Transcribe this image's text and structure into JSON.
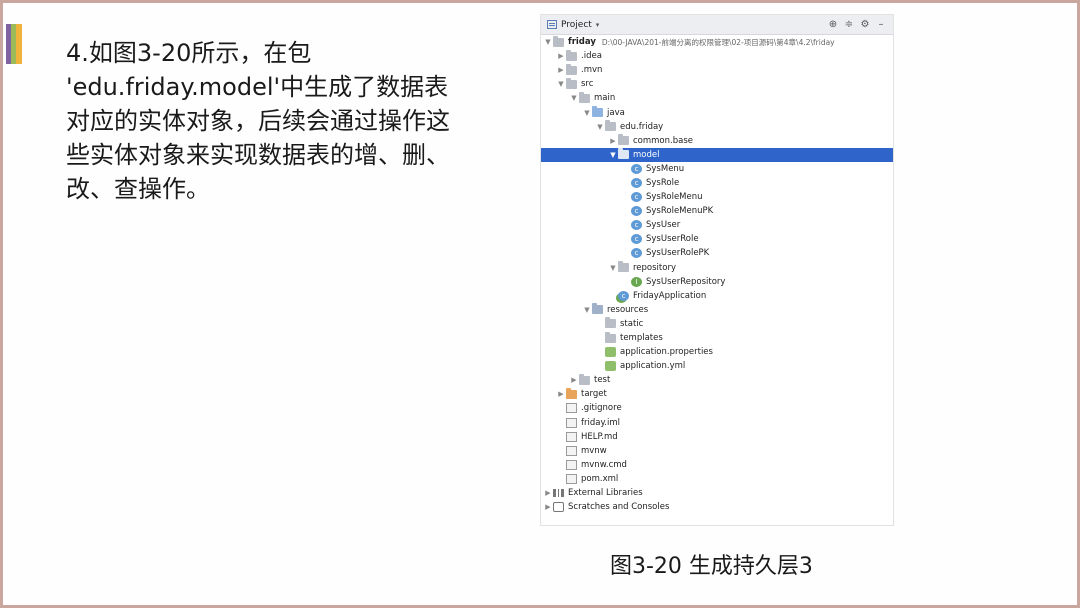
{
  "slide": {
    "text": "4.如图3-20所示，在包\n'edu.friday.model'中生成了数据表\n对应的实体对象，后续会通过操作这\n些实体对象来实现数据表的增、删、\n改、查操作。",
    "caption": "图3-20 生成持久层3"
  },
  "ide": {
    "title": "Project",
    "caret": "▾",
    "header_icons": [
      "target-icon",
      "collapse-icon",
      "gear-icon",
      "minimize-icon"
    ],
    "root": {
      "label": "friday",
      "path": "D:\\00-JAVA\\201-前端分离的权限管理\\02-项目源码\\第4章\\4.2\\friday"
    },
    "tree": [
      {
        "label": ".idea",
        "indent": 1,
        "arrow": "right",
        "icon": "folder"
      },
      {
        "label": ".mvn",
        "indent": 1,
        "arrow": "right",
        "icon": "folder"
      },
      {
        "label": "src",
        "indent": 1,
        "arrow": "down",
        "icon": "folder"
      },
      {
        "label": "main",
        "indent": 2,
        "arrow": "down",
        "icon": "folder"
      },
      {
        "label": "java",
        "indent": 3,
        "arrow": "down",
        "icon": "folder-blue"
      },
      {
        "label": "edu.friday",
        "indent": 4,
        "arrow": "down",
        "icon": "folder"
      },
      {
        "label": "common.base",
        "indent": 5,
        "arrow": "right",
        "icon": "folder"
      },
      {
        "label": "model",
        "indent": 5,
        "arrow": "down",
        "icon": "folder",
        "selected": true
      },
      {
        "label": "SysMenu",
        "indent": 6,
        "arrow": "",
        "icon": "class"
      },
      {
        "label": "SysRole",
        "indent": 6,
        "arrow": "",
        "icon": "class"
      },
      {
        "label": "SysRoleMenu",
        "indent": 6,
        "arrow": "",
        "icon": "class"
      },
      {
        "label": "SysRoleMenuPK",
        "indent": 6,
        "arrow": "",
        "icon": "class"
      },
      {
        "label": "SysUser",
        "indent": 6,
        "arrow": "",
        "icon": "class"
      },
      {
        "label": "SysUserRole",
        "indent": 6,
        "arrow": "",
        "icon": "class"
      },
      {
        "label": "SysUserRolePK",
        "indent": 6,
        "arrow": "",
        "icon": "class"
      },
      {
        "label": "repository",
        "indent": 5,
        "arrow": "down",
        "icon": "folder"
      },
      {
        "label": "SysUserRepository",
        "indent": 6,
        "arrow": "",
        "icon": "interface"
      },
      {
        "label": "FridayApplication",
        "indent": 5,
        "arrow": "",
        "icon": "appclass"
      },
      {
        "label": "resources",
        "indent": 3,
        "arrow": "down",
        "icon": "folder-src"
      },
      {
        "label": "static",
        "indent": 4,
        "arrow": "",
        "icon": "folder"
      },
      {
        "label": "templates",
        "indent": 4,
        "arrow": "",
        "icon": "folder"
      },
      {
        "label": "application.properties",
        "indent": 4,
        "arrow": "",
        "icon": "properties"
      },
      {
        "label": "application.yml",
        "indent": 4,
        "arrow": "",
        "icon": "properties"
      },
      {
        "label": "test",
        "indent": 2,
        "arrow": "right",
        "icon": "folder"
      },
      {
        "label": "target",
        "indent": 1,
        "arrow": "right",
        "icon": "folder-orange"
      },
      {
        "label": ".gitignore",
        "indent": 1,
        "arrow": "",
        "icon": "file"
      },
      {
        "label": "friday.iml",
        "indent": 1,
        "arrow": "",
        "icon": "file"
      },
      {
        "label": "HELP.md",
        "indent": 1,
        "arrow": "",
        "icon": "file"
      },
      {
        "label": "mvnw",
        "indent": 1,
        "arrow": "",
        "icon": "file"
      },
      {
        "label": "mvnw.cmd",
        "indent": 1,
        "arrow": "",
        "icon": "file"
      },
      {
        "label": "pom.xml",
        "indent": 1,
        "arrow": "",
        "icon": "file"
      },
      {
        "label": "External Libraries",
        "indent": 0,
        "arrow": "right",
        "icon": "library"
      },
      {
        "label": "Scratches and Consoles",
        "indent": 0,
        "arrow": "right",
        "icon": "scratch"
      }
    ]
  },
  "colors": {
    "selection": "#2f65ca",
    "frame_border": "#c9a79e",
    "accent": [
      "#8064a2",
      "#9bbb59",
      "#f0b33c"
    ]
  }
}
